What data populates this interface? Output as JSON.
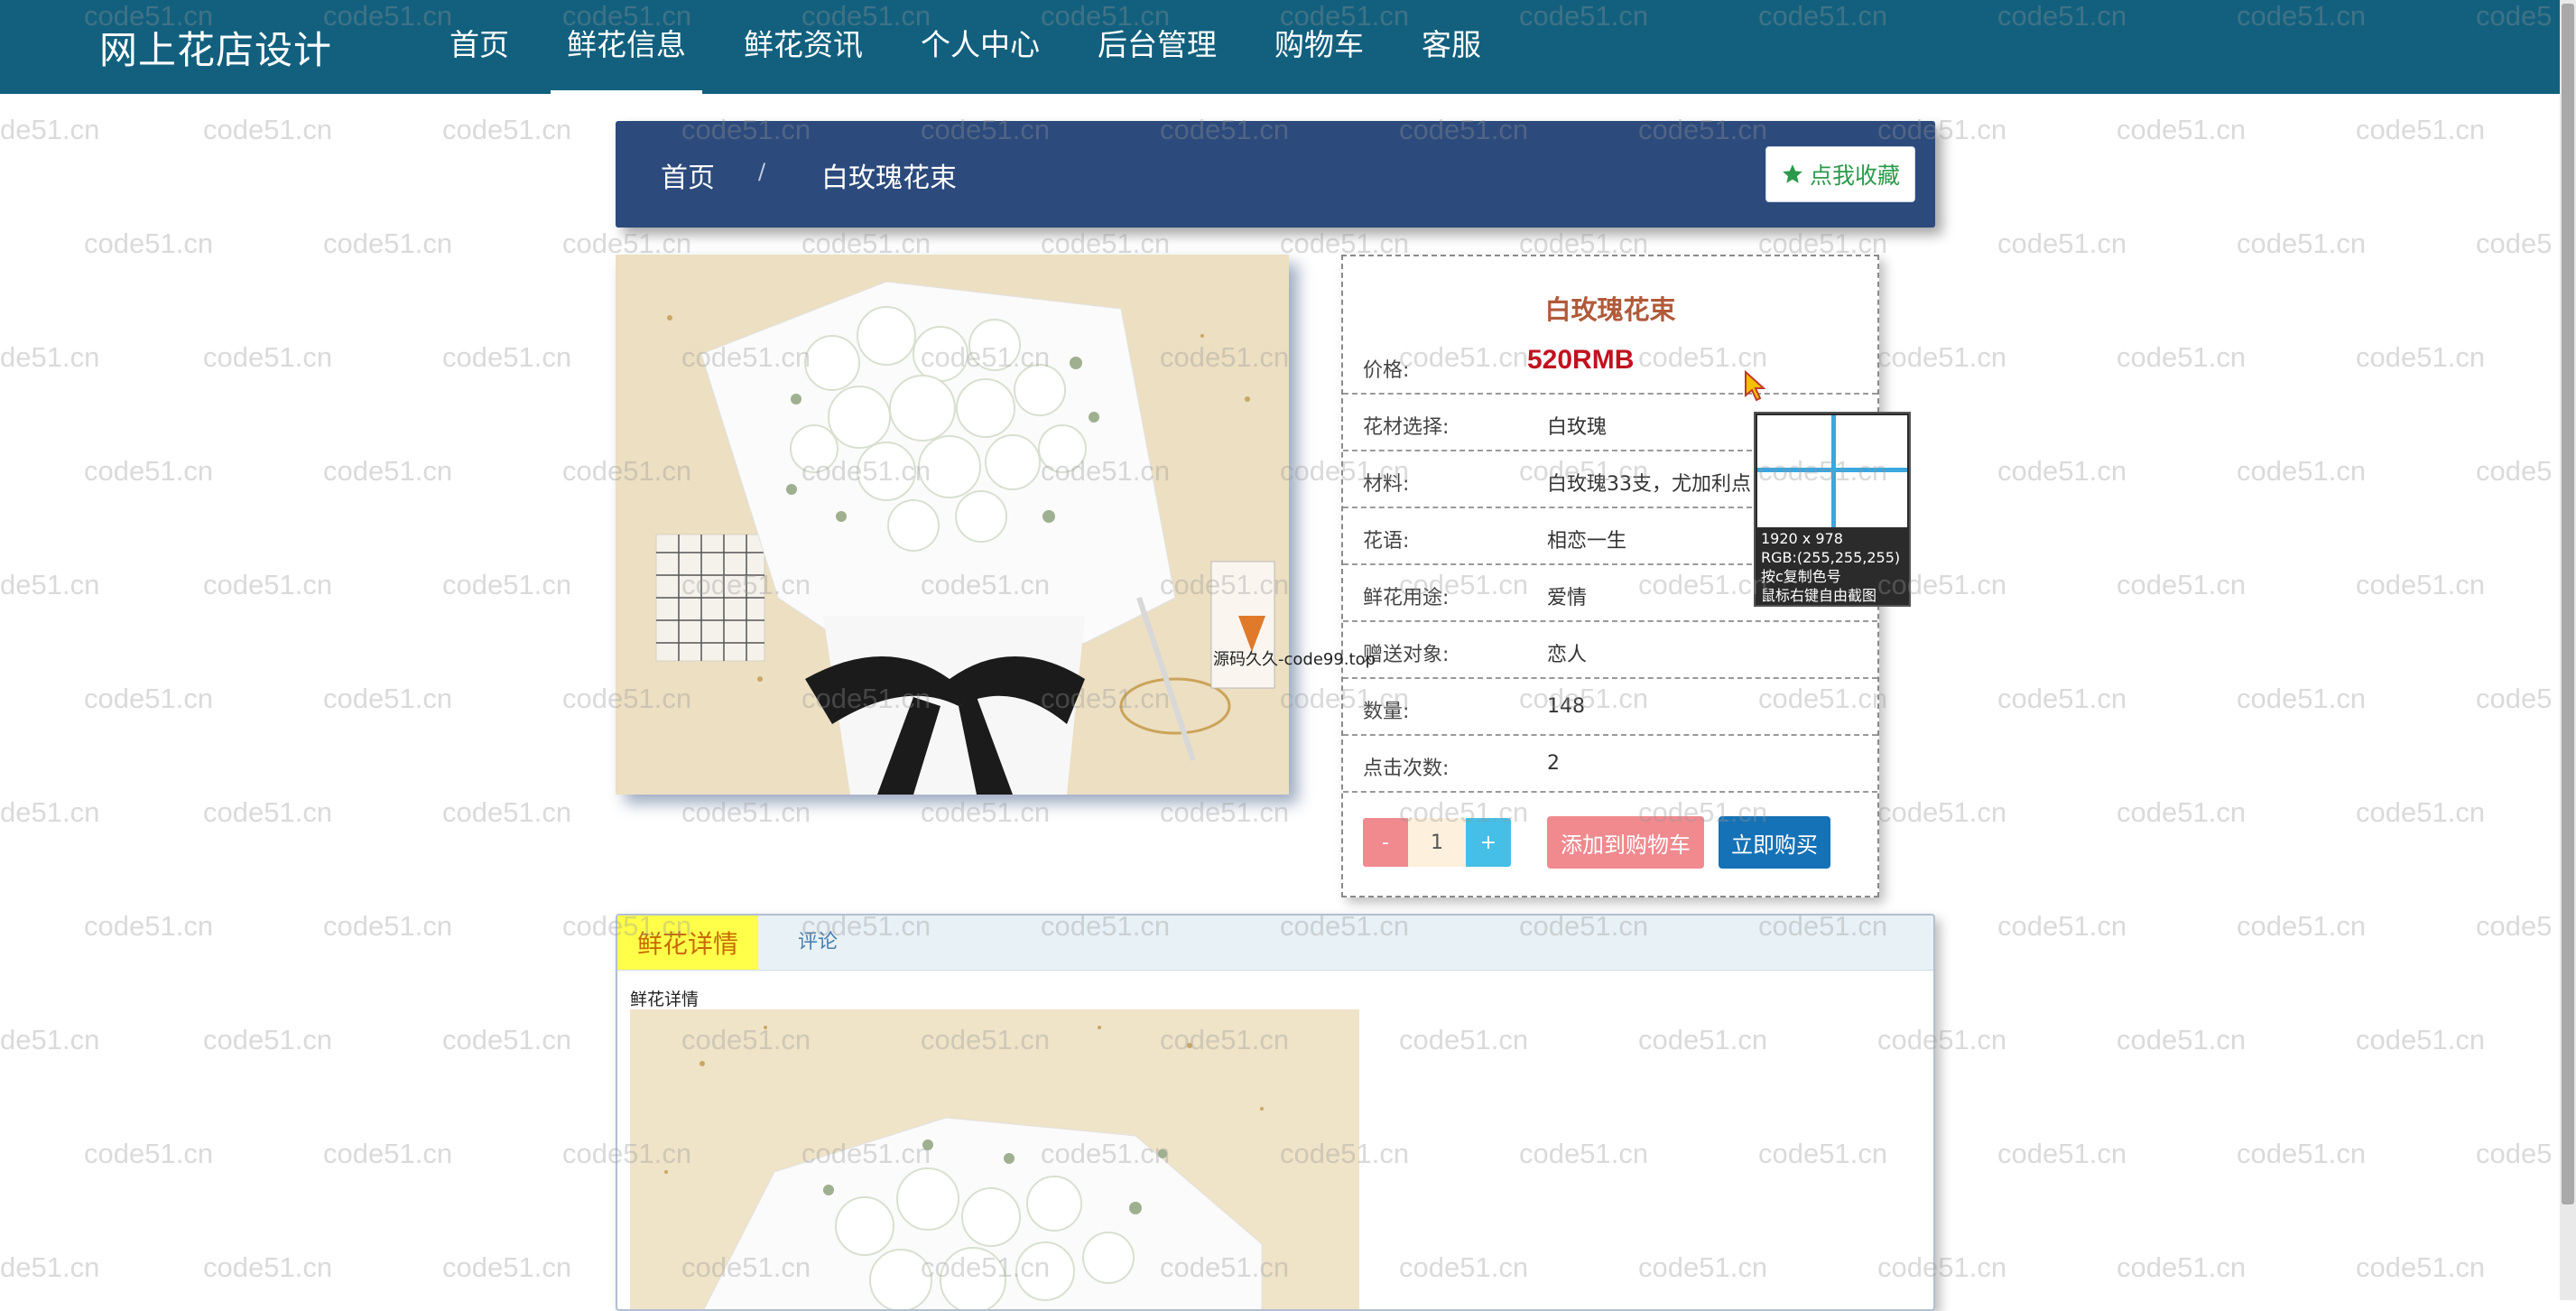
{
  "header": {
    "brand": "网上花店设计",
    "nav": [
      "首页",
      "鲜花信息",
      "鲜花资讯",
      "个人中心",
      "后台管理",
      "购物车",
      "客服"
    ],
    "active_index": 1
  },
  "breadcrumb": {
    "home": "首页",
    "separator": "/",
    "current": "白玫瑰花束",
    "favorite_label": "点我收藏"
  },
  "product": {
    "title": "白玫瑰花束",
    "price_label": "价格:",
    "price": "520RMB",
    "rows": [
      {
        "label": "花材选择:",
        "value": "白玫瑰"
      },
      {
        "label": "材料:",
        "value": "白玫瑰33支，尤加利点"
      },
      {
        "label": "花语:",
        "value": "相恋一生"
      },
      {
        "label": "鲜花用途:",
        "value": "爱情"
      },
      {
        "label": "赠送对象:",
        "value": "恋人"
      },
      {
        "label": "数量:",
        "value": "148"
      },
      {
        "label": "点击次数:",
        "value": "2"
      }
    ],
    "qty_minus": "-",
    "qty_value": "1",
    "qty_plus": "+",
    "add_to_cart": "添加到购物车",
    "buy_now": "立即购买"
  },
  "magnifier": {
    "resolution": "1920 x 978",
    "rgb": "RGB:(255,255,255)",
    "hint_copy": "按c复制色号",
    "hint_capture": "鼠标右键自由截图"
  },
  "source_text": "源码久久-code99.top",
  "tabs": {
    "detail": "鲜花详情",
    "comment": "评论",
    "detail_heading": "鲜花详情"
  },
  "watermark": "code51.cn",
  "watermark_partial": "de51.cn",
  "watermark_cut": "code5",
  "colors": {
    "navbar": "#12607e",
    "breadcrumb": "#2c4a7c",
    "price": "#c1121f",
    "title": "#b05a3a",
    "add_cart": "#f08a8f",
    "buy_now": "#1672b6",
    "active_tab": "#ffff4a"
  }
}
